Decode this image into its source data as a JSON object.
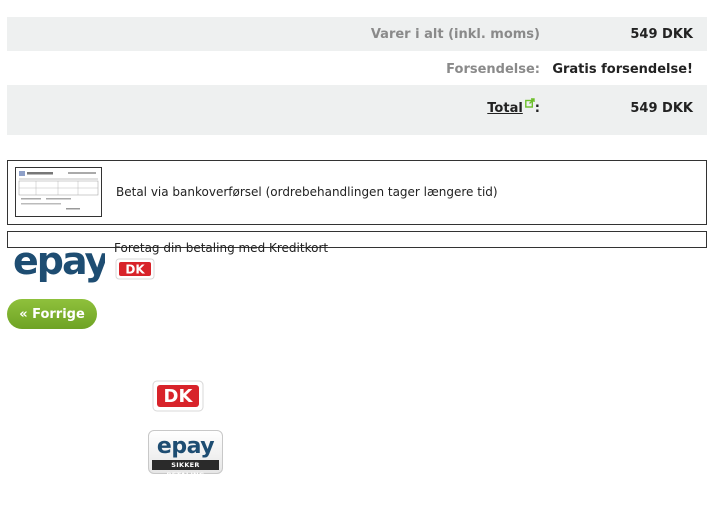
{
  "summary": {
    "items_total_label": "Varer i alt (inkl. moms)",
    "items_total_value": "549 DKK",
    "shipping_label": "Forsendelse:",
    "shipping_value": "Gratis forsendelse!",
    "total_label": "Total",
    "total_suffix": ":",
    "total_value": "549 DKK"
  },
  "payment_methods": {
    "bank_transfer_label": "Betal via bankoverførsel (ordrebehandlingen tager længere tid)",
    "card_label": "Foretag din betaling med Kreditkort"
  },
  "logos": {
    "epay_word": "epay",
    "dk_word": "DK",
    "epay_badge_word": "epay",
    "epay_badge_sub": "SIKKER BETALING"
  },
  "nav": {
    "prev_label": "« Forrige"
  },
  "colors": {
    "row_shade": "#eef0f0",
    "button_green": "#7cb32e",
    "epay_blue": "#1e4d72",
    "dk_red": "#d8232a",
    "external_link_green": "#6cbf2a"
  },
  "icons": {
    "total_link": "external-link-icon"
  }
}
